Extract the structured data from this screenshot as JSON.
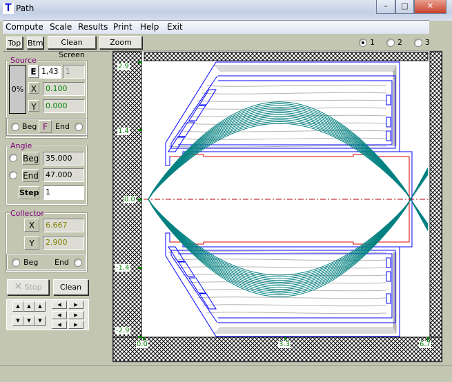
{
  "window": {
    "title": "Path",
    "app_icon_letter": "T",
    "minimize": "–",
    "maximize": "□",
    "close": "✕"
  },
  "menu": [
    "Compute",
    "Scale",
    "Results",
    "Print",
    "Help",
    "Exit"
  ],
  "toolbar": {
    "top": "Top",
    "btm": "Btm",
    "clean_screen": "Clean Screen",
    "zoom": "Zoom",
    "radios": [
      {
        "label": "1",
        "selected": true
      },
      {
        "label": "2",
        "selected": false
      },
      {
        "label": "3",
        "selected": false
      }
    ]
  },
  "source": {
    "title": "Source",
    "progress": "0%",
    "e_label": "E",
    "e_value": "1,43",
    "e_second": "1",
    "x_label": "X",
    "x_value": "0.100",
    "y_label": "Y",
    "y_value": "0.000",
    "beg": "Beg",
    "f": "F",
    "end": "End"
  },
  "angle": {
    "title": "Angle",
    "beg_label": "Beg",
    "beg_value": "35.000",
    "end_label": "End",
    "end_value": "47.000",
    "step_label": "Step",
    "step_value": "1"
  },
  "collector": {
    "title": "Collector",
    "x_label": "X",
    "x_value": "6.667",
    "y_label": "Y",
    "y_value": "2.900",
    "beg": "Beg",
    "end": "End"
  },
  "actions": {
    "stop": "Stop",
    "clean": "Clean"
  },
  "axes": {
    "y_ticks": [
      "2.9",
      "1.4",
      "0.0",
      "-1.4",
      "-2.9"
    ],
    "x_ticks": [
      "0.0",
      "3.3",
      "6.7"
    ]
  },
  "colors": {
    "electrode": "#0000ff",
    "trajectory": "#008080",
    "equipotential": "#b4b4b4",
    "axis_line": "#b00000",
    "tick": "#008000"
  }
}
